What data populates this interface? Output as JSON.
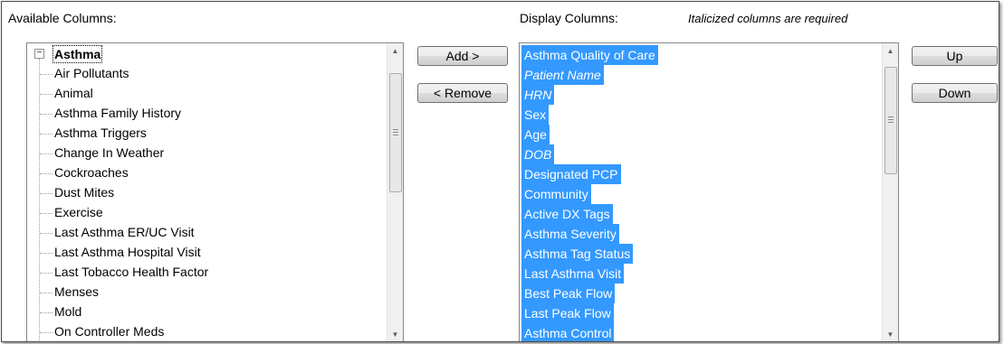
{
  "available": {
    "label": "Available Columns:",
    "root": "Asthma",
    "items": [
      "Air Pollutants",
      "Animal",
      "Asthma Family History",
      "Asthma Triggers",
      "Change In Weather",
      "Cockroaches",
      "Dust Mites",
      "Exercise",
      "Last Asthma ER/UC Visit",
      "Last Asthma Hospital Visit",
      "Last Tobacco Health Factor",
      "Menses",
      "Mold",
      "On Controller Meds"
    ]
  },
  "display": {
    "label": "Display Columns:",
    "required_note": "Italicized columns are required",
    "items": [
      {
        "label": "Asthma Quality of Care",
        "required": false
      },
      {
        "label": "Patient Name",
        "required": true
      },
      {
        "label": "HRN",
        "required": true
      },
      {
        "label": "Sex",
        "required": false
      },
      {
        "label": "Age",
        "required": false
      },
      {
        "label": "DOB",
        "required": true
      },
      {
        "label": "Designated PCP",
        "required": false
      },
      {
        "label": "Community",
        "required": false
      },
      {
        "label": "Active DX Tags",
        "required": false
      },
      {
        "label": "Asthma Severity",
        "required": false
      },
      {
        "label": "Asthma Tag Status",
        "required": false
      },
      {
        "label": "Last Asthma Visit",
        "required": false
      },
      {
        "label": "Best Peak Flow",
        "required": false
      },
      {
        "label": "Last Peak Flow",
        "required": false
      },
      {
        "label": "Asthma Control",
        "required": false
      }
    ]
  },
  "buttons": {
    "add": "Add >",
    "remove": "< Remove",
    "up": "Up",
    "down": "Down"
  },
  "colors": {
    "selection": "#3399ff",
    "selection_text": "#ffffff"
  },
  "icons": {
    "expander": "minus-box-icon",
    "scroll_up": "scroll-up-arrow-icon",
    "scroll_down": "scroll-down-arrow-icon"
  }
}
